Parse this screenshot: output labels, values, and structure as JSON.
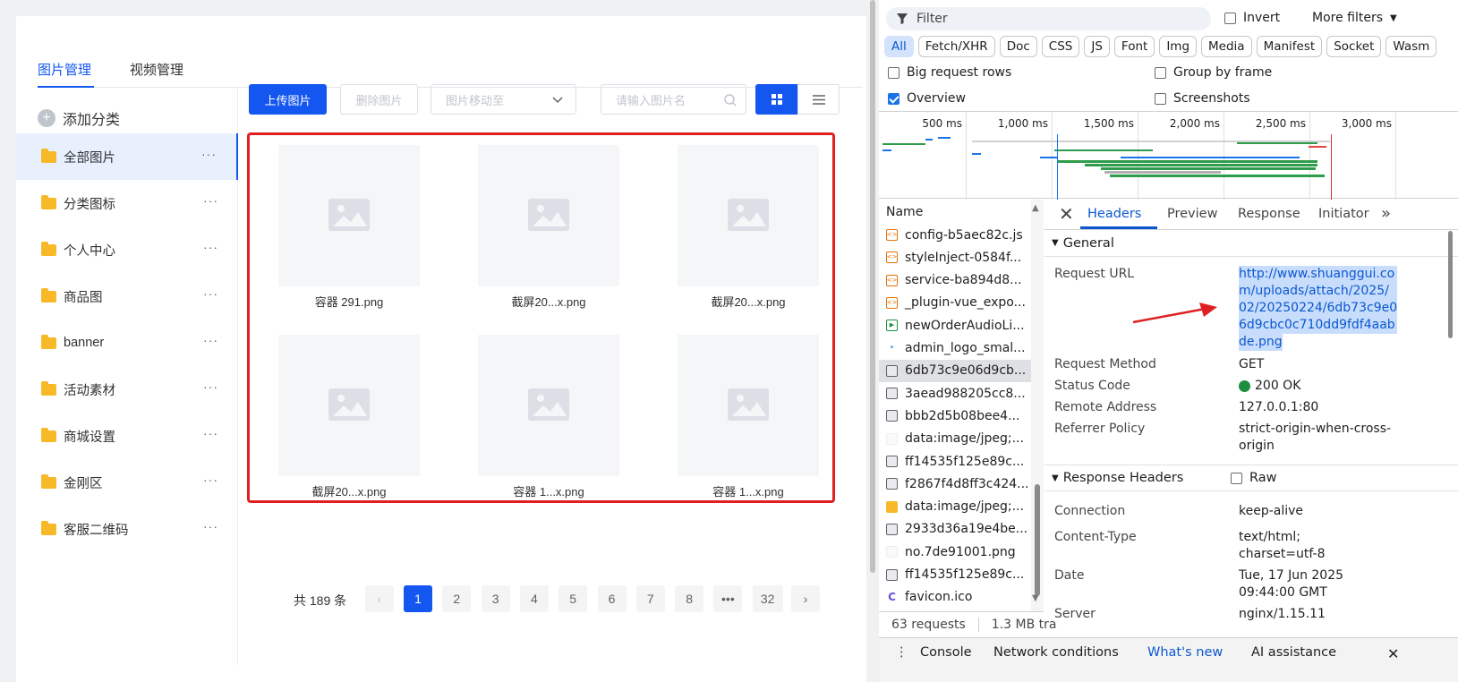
{
  "app": {
    "tabs": [
      "图片管理",
      "视频管理"
    ],
    "add_category": "添加分类",
    "categories": [
      "全部图片",
      "分类图标",
      "个人中心",
      "商品图",
      "banner",
      "活动素材",
      "商城设置",
      "金刚区",
      "客服二维码"
    ],
    "more_dots": "···",
    "toolbar": {
      "upload": "上传图片",
      "delete": "删除图片",
      "move_placeholder": "图片移动至",
      "search_placeholder": "请输入图片名"
    },
    "images": [
      "容器 291.png",
      "截屏20...x.png",
      "截屏20...x.png",
      "截屏20...x.png",
      "容器 1...x.png",
      "容器 1...x.png"
    ],
    "pagination": {
      "total": "共 189 条",
      "pages": [
        "1",
        "2",
        "3",
        "4",
        "5",
        "6",
        "7",
        "8",
        "•••",
        "32"
      ],
      "current": "1",
      "prev": "‹",
      "next": "›"
    },
    "colors": {
      "primary": "#1456f0",
      "highlight_border": "#e02020"
    }
  },
  "devtools": {
    "filter_placeholder": "Filter",
    "invert": "Invert",
    "more_filters": "More filters",
    "type_chips": [
      "All",
      "Fetch/XHR",
      "Doc",
      "CSS",
      "JS",
      "Font",
      "Img",
      "Media",
      "Manifest",
      "Socket",
      "Wasm"
    ],
    "options": {
      "big_rows": "Big request rows",
      "group_by_frame": "Group by frame",
      "overview": "Overview",
      "screenshots": "Screenshots"
    },
    "timeline_labels": [
      "500 ms",
      "1,000 ms",
      "1,500 ms",
      "2,000 ms",
      "2,500 ms",
      "3,000 ms"
    ],
    "name_header": "Name",
    "requests": [
      {
        "name": "config-b5aec82c.js",
        "type": "script"
      },
      {
        "name": "styleInject-0584f...",
        "type": "script"
      },
      {
        "name": "service-ba894d8...",
        "type": "script"
      },
      {
        "name": "_plugin-vue_expo...",
        "type": "script"
      },
      {
        "name": "newOrderAudioLi...",
        "type": "media"
      },
      {
        "name": "admin_logo_smal...",
        "type": "dot"
      },
      {
        "name": "6db73c9e06d9cb...",
        "type": "image"
      },
      {
        "name": "3aead988205cc8...",
        "type": "image"
      },
      {
        "name": "bbb2d5b08bee4...",
        "type": "image"
      },
      {
        "name": "data:image/jpeg;...",
        "type": "blank"
      },
      {
        "name": "ff14535f125e89c...",
        "type": "image"
      },
      {
        "name": "f2867f4d8ff3c424...",
        "type": "image"
      },
      {
        "name": "data:image/jpeg;...",
        "type": "folder"
      },
      {
        "name": "2933d36a19e4be...",
        "type": "image"
      },
      {
        "name": "no.7de91001.png",
        "type": "blank"
      },
      {
        "name": "ff14535f125e89c...",
        "type": "image"
      },
      {
        "name": "favicon.ico",
        "type": "favicon"
      }
    ],
    "selected_request_index": 6,
    "status_requests": "63 requests",
    "status_size": "1.3 MB tra",
    "detail_tabs": [
      "Headers",
      "Preview",
      "Response",
      "Initiator"
    ],
    "general_label": "General",
    "general": {
      "request_url_label": "Request URL",
      "request_url_lines": [
        "http://www.shuanggui.co",
        "m/uploads/attach/2025/",
        "02/20250224/6db73c9e0",
        "6d9cbc0c710dd9fdf4aab",
        "de.png"
      ],
      "request_method_label": "Request Method",
      "request_method": "GET",
      "status_code_label": "Status Code",
      "status_code": "200 OK",
      "remote_address_label": "Remote Address",
      "remote_address": "127.0.0.1:80",
      "referrer_policy_label": "Referrer Policy",
      "referrer_policy_lines": [
        "strict-origin-when-cross-",
        "origin"
      ]
    },
    "response_headers_label": "Response Headers",
    "raw_label": "Raw",
    "response_headers": {
      "connection_label": "Connection",
      "connection": "keep-alive",
      "content_type_label": "Content-Type",
      "content_type_lines": [
        "text/html;",
        "charset=utf-8"
      ],
      "date_label": "Date",
      "date_lines": [
        "Tue, 17 Jun 2025",
        "09:44:00 GMT"
      ],
      "server_label": "Server",
      "server": "nginx/1.15.11"
    },
    "drawer_tabs": [
      "Console",
      "Network conditions",
      "What's new",
      "AI assistance"
    ]
  }
}
